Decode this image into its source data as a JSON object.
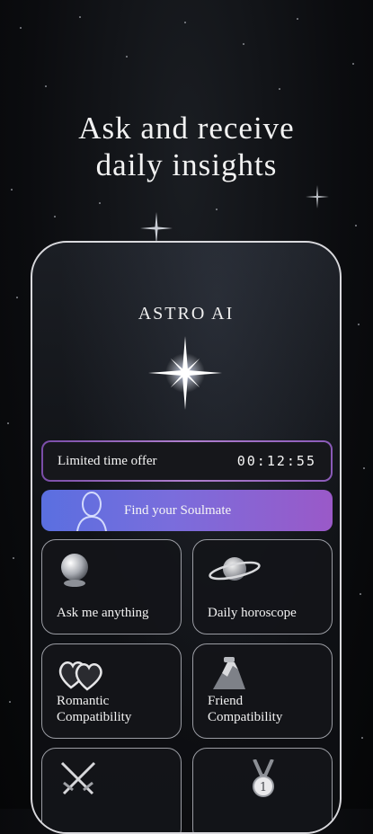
{
  "headline": {
    "line1": "Ask and receive",
    "line2": "daily insights"
  },
  "app": {
    "title": "ASTRO AI"
  },
  "offer": {
    "label": "Limited time offer",
    "timer": "00:12:55"
  },
  "soulmate": {
    "label": "Find your Soulmate",
    "icon": "human-silhouette-icon"
  },
  "cards": [
    {
      "line1": "Ask me anything",
      "line2": "",
      "icon": "crystal-ball-icon"
    },
    {
      "line1": "Daily horoscope",
      "line2": "",
      "icon": "planet-icon"
    },
    {
      "line1": "Romantic",
      "line2": "Compatibility",
      "icon": "hearts-icon"
    },
    {
      "line1": "Friend",
      "line2": "Compatibility",
      "icon": "handshake-icon"
    },
    {
      "line1": "",
      "line2": "",
      "icon": "crossed-swords-icon"
    },
    {
      "line1": "",
      "line2": "",
      "icon": "medal-icon"
    }
  ],
  "colors": {
    "background": "#0b0c0f",
    "offer_border": "#b07fcf",
    "soulmate_gradient_start": "#5a6fe0",
    "soulmate_gradient_end": "#9a59c8",
    "card_border": "#9a9ca3"
  }
}
